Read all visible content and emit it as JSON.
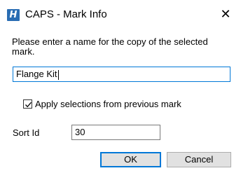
{
  "window": {
    "title": "CAPS - Mark Info",
    "app_icon": "caps-app-icon",
    "close_glyph": "✕"
  },
  "dialog": {
    "prompt": "Please enter a name for the copy of the selected mark.",
    "name_value": "Flange Kit",
    "apply_checkbox": {
      "label": "Apply selections from previous mark",
      "checked": true
    },
    "sort_id": {
      "label": "Sort Id",
      "value": "30"
    },
    "buttons": {
      "ok_label": "OK",
      "cancel_label": "Cancel"
    }
  },
  "colors": {
    "accent": "#0078d7",
    "app_icon": "#2a6db3"
  }
}
